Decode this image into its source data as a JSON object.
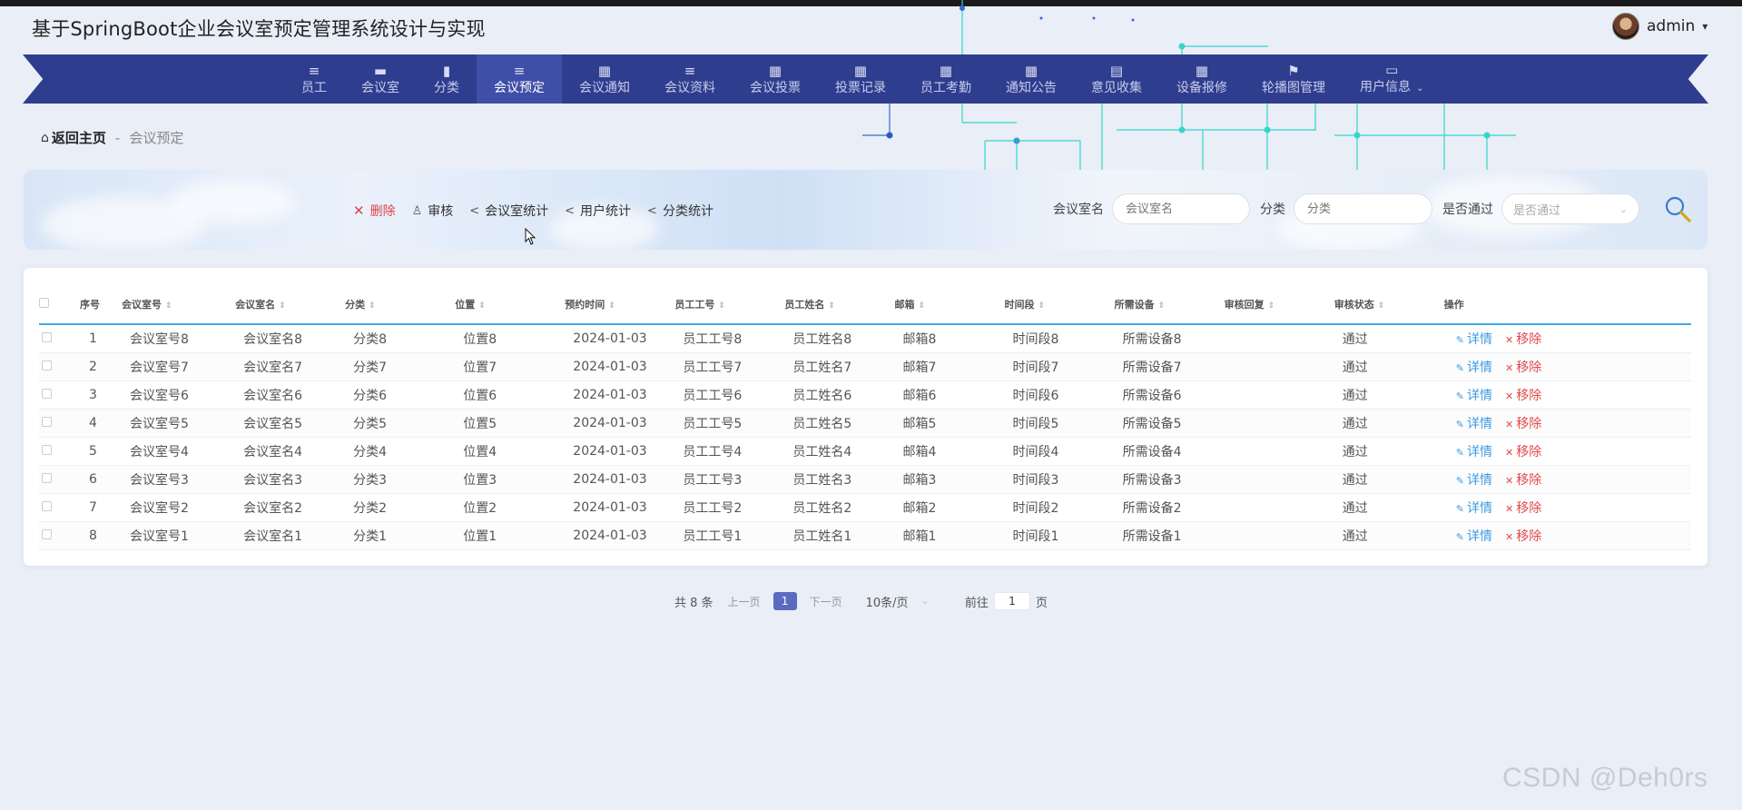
{
  "app": {
    "title": "基于SpringBoot企业会议室预定管理系统设计与实现",
    "user": "admin",
    "user_caret": "▾"
  },
  "nav": {
    "items": [
      {
        "label": "员工",
        "icon": "≡"
      },
      {
        "label": "会议室",
        "icon": "▬"
      },
      {
        "label": "分类",
        "icon": "▮"
      },
      {
        "label": "会议预定",
        "icon": "≡",
        "active": true
      },
      {
        "label": "会议通知",
        "icon": "▦"
      },
      {
        "label": "会议资料",
        "icon": "≡"
      },
      {
        "label": "会议投票",
        "icon": "▦"
      },
      {
        "label": "投票记录",
        "icon": "▦"
      },
      {
        "label": "员工考勤",
        "icon": "▦"
      },
      {
        "label": "通知公告",
        "icon": "▦"
      },
      {
        "label": "意见收集",
        "icon": "▤"
      },
      {
        "label": "设备报修",
        "icon": "▦"
      },
      {
        "label": "轮播图管理",
        "icon": "⚑"
      },
      {
        "label": "用户信息",
        "icon": "▭",
        "submenu": "⌄"
      }
    ]
  },
  "breadcrumb": {
    "home_icon": "⌂",
    "home": "返回主页",
    "sep": "-",
    "current": "会议预定"
  },
  "toolbar": {
    "delete": "删除",
    "audit": "审核",
    "room_stats": "会议室统计",
    "user_stats": "用户统计",
    "category_stats": "分类统计"
  },
  "search": {
    "room_label": "会议室名",
    "room_placeholder": "会议室名",
    "category_label": "分类",
    "category_placeholder": "分类",
    "pass_label": "是否通过",
    "pass_placeholder": "是否通过"
  },
  "table": {
    "headers": [
      "序号",
      "会议室号",
      "会议室名",
      "分类",
      "位置",
      "预约时间",
      "员工工号",
      "员工姓名",
      "邮箱",
      "时间段",
      "所需设备",
      "审核回复",
      "审核状态",
      "操作"
    ],
    "detail_label": "详情",
    "remove_label": "移除",
    "rows": [
      [
        "1",
        "会议室号8",
        "会议室名8",
        "分类8",
        "位置8",
        "2024-01-03",
        "员工工号8",
        "员工姓名8",
        "邮箱8",
        "时间段8",
        "所需设备8",
        "",
        "通过"
      ],
      [
        "2",
        "会议室号7",
        "会议室名7",
        "分类7",
        "位置7",
        "2024-01-03",
        "员工工号7",
        "员工姓名7",
        "邮箱7",
        "时间段7",
        "所需设备7",
        "",
        "通过"
      ],
      [
        "3",
        "会议室号6",
        "会议室名6",
        "分类6",
        "位置6",
        "2024-01-03",
        "员工工号6",
        "员工姓名6",
        "邮箱6",
        "时间段6",
        "所需设备6",
        "",
        "通过"
      ],
      [
        "4",
        "会议室号5",
        "会议室名5",
        "分类5",
        "位置5",
        "2024-01-03",
        "员工工号5",
        "员工姓名5",
        "邮箱5",
        "时间段5",
        "所需设备5",
        "",
        "通过"
      ],
      [
        "5",
        "会议室号4",
        "会议室名4",
        "分类4",
        "位置4",
        "2024-01-03",
        "员工工号4",
        "员工姓名4",
        "邮箱4",
        "时间段4",
        "所需设备4",
        "",
        "通过"
      ],
      [
        "6",
        "会议室号3",
        "会议室名3",
        "分类3",
        "位置3",
        "2024-01-03",
        "员工工号3",
        "员工姓名3",
        "邮箱3",
        "时间段3",
        "所需设备3",
        "",
        "通过"
      ],
      [
        "7",
        "会议室号2",
        "会议室名2",
        "分类2",
        "位置2",
        "2024-01-03",
        "员工工号2",
        "员工姓名2",
        "邮箱2",
        "时间段2",
        "所需设备2",
        "",
        "通过"
      ],
      [
        "8",
        "会议室号1",
        "会议室名1",
        "分类1",
        "位置1",
        "2024-01-03",
        "员工工号1",
        "员工姓名1",
        "邮箱1",
        "时间段1",
        "所需设备1",
        "",
        "通过"
      ]
    ]
  },
  "pagination": {
    "total": "共 8 条",
    "prev": "上一页",
    "current": "1",
    "next": "下一页",
    "page_size": "10条/页",
    "goto_prefix": "前往",
    "goto_value": "1",
    "goto_suffix": "页"
  },
  "watermark": "CSDN @Deh0rs",
  "colors": {
    "nav_bg": "#2f3d8f",
    "nav_active": "#3f4ea8",
    "accent_line": "#41a9e1",
    "danger": "#e0434a",
    "link": "#3b9be0",
    "page_active": "#5b6bc0"
  }
}
